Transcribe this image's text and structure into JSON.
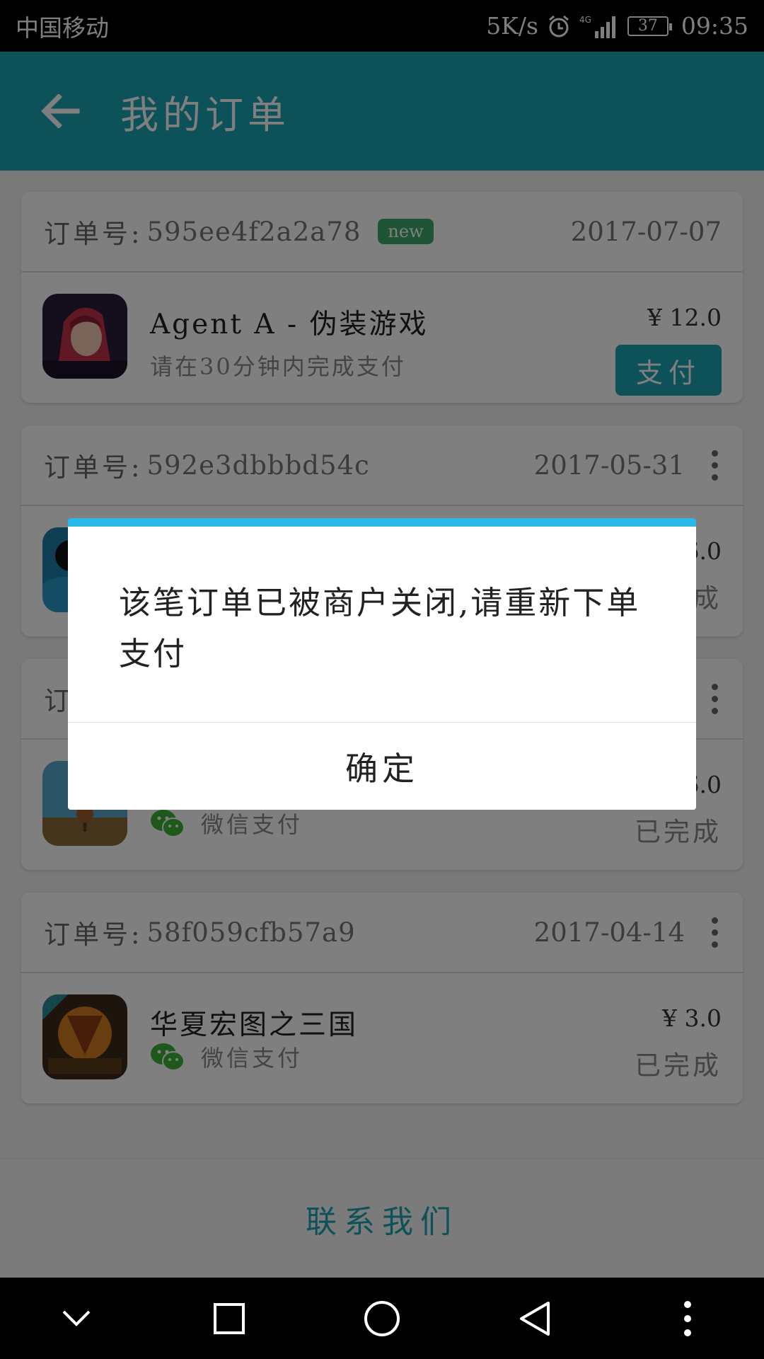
{
  "status_bar": {
    "carrier": "中国移动",
    "speed": "5K/s",
    "network": "4G",
    "battery": "37",
    "time": "09:35"
  },
  "app_bar": {
    "title": "我的订单"
  },
  "orders": [
    {
      "label": "订单号:",
      "order_no": "595ee4f2a2a78",
      "badge": "new",
      "date": "2017-07-07",
      "game": "Agent A - 伪装游戏",
      "sub": "请在30分钟内完成支付",
      "price": "¥ 12.0",
      "action": "支付"
    },
    {
      "label": "订单号:",
      "order_no": "592e3dbbbd54c",
      "date": "2017-05-31",
      "price": "¥ 6.0",
      "status": "已完成"
    },
    {
      "label": "订单号:",
      "order_no": "",
      "date": "",
      "price": "¥ 6.0",
      "pay_method": "微信支付",
      "status": "已完成"
    },
    {
      "label": "订单号:",
      "order_no": "58f059cfb57a9",
      "date": "2017-04-14",
      "game": "华夏宏图之三国",
      "pay_method": "微信支付",
      "price": "¥ 3.0",
      "status": "已完成"
    }
  ],
  "contact": {
    "label": "联系我们"
  },
  "dialog": {
    "message": "该笔订单已被商户关闭,请重新下单支付",
    "confirm": "确定"
  },
  "colors": {
    "primary": "#1ba5b3",
    "dialog_accent": "#29b6e8",
    "badge": "#3fa86a",
    "wechat": "#3cb034"
  },
  "nav": {
    "icons": [
      "chevron-down-icon",
      "square-icon",
      "home-circle-icon",
      "back-triangle-icon",
      "more-icon"
    ]
  }
}
